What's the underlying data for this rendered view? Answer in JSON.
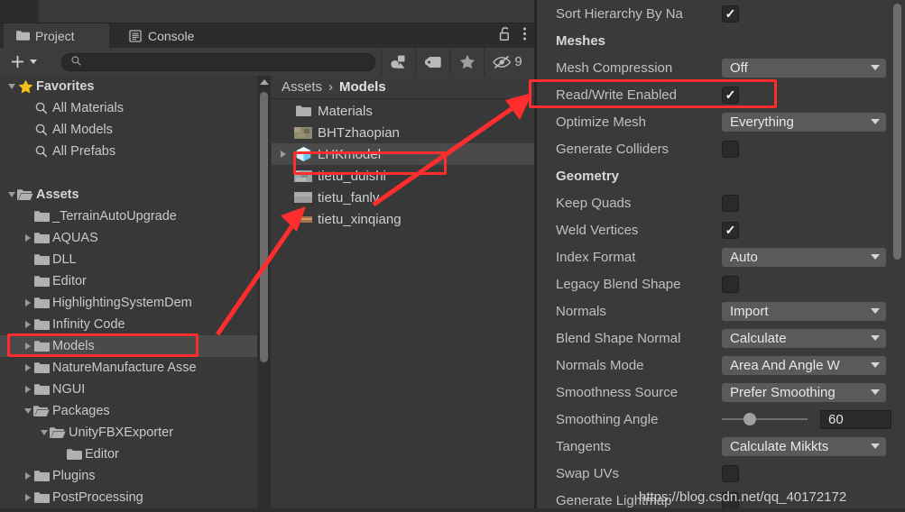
{
  "window": {
    "project_tab": "Project",
    "console_tab": "Console",
    "hidden_count": "9",
    "search_placeholder": ""
  },
  "toolbar": {
    "add_label": "+",
    "icons": [
      "search-icon",
      "type-filter-icon",
      "label-filter-icon",
      "favorite-star-icon",
      "hidden-eye-icon"
    ]
  },
  "tree": {
    "items": [
      {
        "label": "Favorites",
        "indent": 0,
        "twisty": "down",
        "icon": "star-icon",
        "bold": true,
        "selected": false
      },
      {
        "label": "All Materials",
        "indent": 1,
        "twisty": "none",
        "icon": "search-icon",
        "bold": false,
        "selected": false
      },
      {
        "label": "All Models",
        "indent": 1,
        "twisty": "none",
        "icon": "search-icon",
        "bold": false,
        "selected": false
      },
      {
        "label": "All Prefabs",
        "indent": 1,
        "twisty": "none",
        "icon": "search-icon",
        "bold": false,
        "selected": false
      },
      {
        "label": "",
        "indent": 0,
        "twisty": "none",
        "icon": "none",
        "bold": false,
        "selected": false
      },
      {
        "label": "Assets",
        "indent": 0,
        "twisty": "down",
        "icon": "folder-open-icon",
        "bold": true,
        "selected": false
      },
      {
        "label": "_TerrainAutoUpgrade",
        "indent": 1,
        "twisty": "none",
        "icon": "folder-icon",
        "bold": false,
        "selected": false
      },
      {
        "label": "AQUAS",
        "indent": 1,
        "twisty": "right",
        "icon": "folder-icon",
        "bold": false,
        "selected": false
      },
      {
        "label": "DLL",
        "indent": 1,
        "twisty": "none",
        "icon": "folder-icon",
        "bold": false,
        "selected": false
      },
      {
        "label": "Editor",
        "indent": 1,
        "twisty": "none",
        "icon": "folder-icon",
        "bold": false,
        "selected": false
      },
      {
        "label": "HighlightingSystemDem",
        "indent": 1,
        "twisty": "right",
        "icon": "folder-icon",
        "bold": false,
        "selected": false
      },
      {
        "label": "Infinity Code",
        "indent": 1,
        "twisty": "right",
        "icon": "folder-icon",
        "bold": false,
        "selected": false
      },
      {
        "label": "Models",
        "indent": 1,
        "twisty": "right",
        "icon": "folder-icon",
        "bold": false,
        "selected": true
      },
      {
        "label": "NatureManufacture Asse",
        "indent": 1,
        "twisty": "right",
        "icon": "folder-icon",
        "bold": false,
        "selected": false
      },
      {
        "label": "NGUI",
        "indent": 1,
        "twisty": "right",
        "icon": "folder-icon",
        "bold": false,
        "selected": false
      },
      {
        "label": "Packages",
        "indent": 1,
        "twisty": "down",
        "icon": "folder-open-icon",
        "bold": false,
        "selected": false
      },
      {
        "label": "UnityFBXExporter",
        "indent": 2,
        "twisty": "down",
        "icon": "folder-open-icon",
        "bold": false,
        "selected": false
      },
      {
        "label": "Editor",
        "indent": 3,
        "twisty": "none",
        "icon": "folder-icon",
        "bold": false,
        "selected": false
      },
      {
        "label": "Plugins",
        "indent": 1,
        "twisty": "right",
        "icon": "folder-icon",
        "bold": false,
        "selected": false
      },
      {
        "label": "PostProcessing",
        "indent": 1,
        "twisty": "right",
        "icon": "folder-icon",
        "bold": false,
        "selected": false
      }
    ]
  },
  "breadcrumb": {
    "root": "Assets",
    "separator": "›",
    "current": "Models"
  },
  "assets": {
    "items": [
      {
        "label": "Materials",
        "icon": "folder-icon",
        "twisty": "none",
        "selected": false
      },
      {
        "label": "BHTzhaopian",
        "icon": "texture-thumb-brown",
        "twisty": "none",
        "selected": false
      },
      {
        "label": "LHKmodel",
        "icon": "prefab-cube-icon",
        "twisty": "right",
        "selected": true
      },
      {
        "label": "tietu_duishi",
        "icon": "texture-thumb-gray",
        "twisty": "none",
        "selected": false
      },
      {
        "label": "tietu_fanlv",
        "icon": "texture-thumb-flat",
        "twisty": "none",
        "selected": false
      },
      {
        "label": "tietu_xinqiang",
        "icon": "texture-thumb-stripe",
        "twisty": "none",
        "selected": false
      }
    ]
  },
  "inspector": {
    "rows": [
      {
        "label": "Sort Hierarchy By Na",
        "type": "checkbox",
        "value": true,
        "header": false
      },
      {
        "label": "Meshes",
        "type": "none",
        "value": null,
        "header": true
      },
      {
        "label": "Mesh Compression",
        "type": "dropdown",
        "value": "Off",
        "header": false
      },
      {
        "label": "Read/Write Enabled",
        "type": "checkbox",
        "value": true,
        "header": false
      },
      {
        "label": "Optimize Mesh",
        "type": "dropdown",
        "value": "Everything",
        "header": false
      },
      {
        "label": "Generate Colliders",
        "type": "checkbox",
        "value": false,
        "header": false
      },
      {
        "label": "Geometry",
        "type": "none",
        "value": null,
        "header": true
      },
      {
        "label": "Keep Quads",
        "type": "checkbox",
        "value": false,
        "header": false
      },
      {
        "label": "Weld Vertices",
        "type": "checkbox",
        "value": true,
        "header": false
      },
      {
        "label": "Index Format",
        "type": "dropdown",
        "value": "Auto",
        "header": false
      },
      {
        "label": "Legacy Blend Shape",
        "type": "checkbox",
        "value": false,
        "header": false
      },
      {
        "label": "Normals",
        "type": "dropdown",
        "value": "Import",
        "header": false
      },
      {
        "label": "Blend Shape Normal",
        "type": "dropdown",
        "value": "Calculate",
        "header": false
      },
      {
        "label": "Normals Mode",
        "type": "dropdown",
        "value": "Area And Angle W",
        "header": false
      },
      {
        "label": "Smoothness Source",
        "type": "dropdown",
        "value": "Prefer Smoothing",
        "header": false
      },
      {
        "label": "Smoothing Angle",
        "type": "slider",
        "value": "60",
        "header": false
      },
      {
        "label": "Tangents",
        "type": "dropdown",
        "value": "Calculate Mikkts",
        "header": false
      },
      {
        "label": "Swap UVs",
        "type": "checkbox",
        "value": false,
        "header": false
      },
      {
        "label": "Generate Lightmap",
        "type": "checkbox",
        "value": false,
        "header": false
      }
    ]
  },
  "watermark": {
    "text": "https://blog.csdn.net/qq_40172172"
  },
  "annotation": {
    "color": "#ff2d2d"
  }
}
